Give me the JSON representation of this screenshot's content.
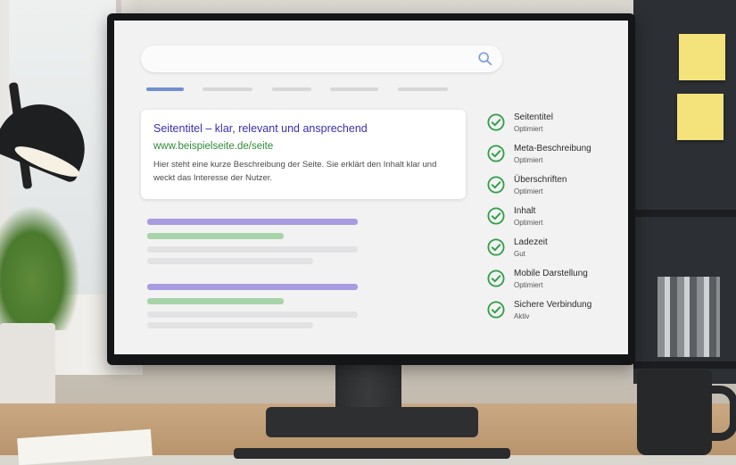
{
  "colors": {
    "accent_tab": "#6f8fd0",
    "title_link": "#3a2fb0",
    "url_green": "#2f8a36",
    "check_green": "#2f9e44",
    "placeholder_purple": "#a99be0",
    "placeholder_green": "#a7d3a9",
    "placeholder_gray": "#e2e2e4"
  },
  "search": {
    "icon": "search-icon"
  },
  "result": {
    "title": "Seitentitel – klar, relevant und ansprechend",
    "url": "www.beispielseite.de/seite",
    "description": "Hier steht eine kurze Beschreibung der Seite. Sie erklärt den Inhalt klar und weckt das Interesse der Nutzer."
  },
  "checklist": [
    {
      "label": "Seitentitel",
      "status": "Optimiert",
      "icon": "check-circle-icon"
    },
    {
      "label": "Meta-Beschreibung",
      "status": "Optimiert",
      "icon": "check-circle-icon"
    },
    {
      "label": "Überschriften",
      "status": "Optimiert",
      "icon": "check-circle-icon"
    },
    {
      "label": "Inhalt",
      "status": "Optimiert",
      "icon": "check-circle-icon"
    },
    {
      "label": "Ladezeit",
      "status": "Gut",
      "icon": "check-circle-icon"
    },
    {
      "label": "Mobile Darstellung",
      "status": "Optimiert",
      "icon": "check-circle-icon"
    },
    {
      "label": "Sichere Verbindung",
      "status": "Aktiv",
      "icon": "check-circle-icon"
    }
  ]
}
